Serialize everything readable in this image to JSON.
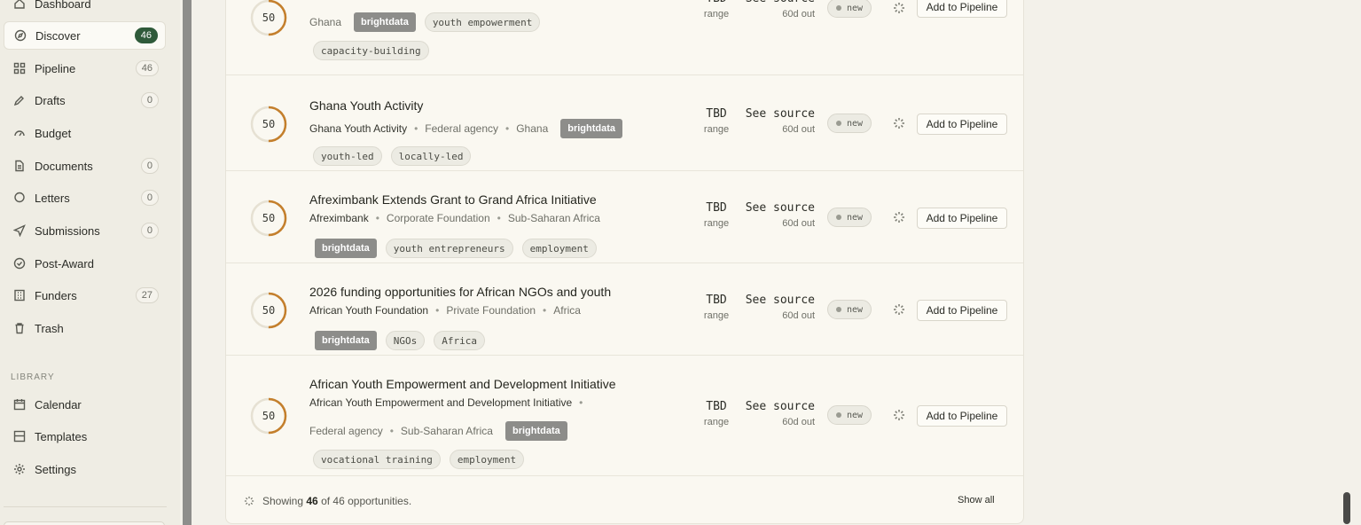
{
  "sidebar": {
    "items": [
      {
        "label": "Dashboard",
        "icon": "home-icon",
        "badge": ""
      },
      {
        "label": "Discover",
        "icon": "compass-icon",
        "badge": "46"
      },
      {
        "label": "Pipeline",
        "icon": "pipeline-icon",
        "badge": "46"
      },
      {
        "label": "Drafts",
        "icon": "pen-icon",
        "badge": "0"
      },
      {
        "label": "Budget",
        "icon": "gauge-icon",
        "badge": ""
      },
      {
        "label": "Documents",
        "icon": "document-icon",
        "badge": "0"
      },
      {
        "label": "Letters",
        "icon": "chat-icon",
        "badge": "0"
      },
      {
        "label": "Submissions",
        "icon": "send-icon",
        "badge": "0"
      },
      {
        "label": "Post-Award",
        "icon": "check-circle-icon",
        "badge": ""
      },
      {
        "label": "Funders",
        "icon": "building-icon",
        "badge": "27"
      },
      {
        "label": "Trash",
        "icon": "trash-icon",
        "badge": ""
      }
    ],
    "library_label": "LIBRARY",
    "library": [
      {
        "label": "Calendar",
        "icon": "calendar-icon"
      },
      {
        "label": "Templates",
        "icon": "template-icon"
      },
      {
        "label": "Settings",
        "icon": "gear-icon"
      }
    ]
  },
  "opportunities": [
    {
      "score": "50",
      "score_fraction": 0.5,
      "title": "",
      "meta": [
        "Ghana"
      ],
      "inline_brand": true,
      "inline_tags": [
        "youth empowerment"
      ],
      "tags_brand": false,
      "tags": [
        "capacity-building"
      ],
      "amount": "TBD",
      "amount_sub": "range",
      "deadline": "See source",
      "deadline_sub": "60d out",
      "status": "new",
      "action": "Add to Pipeline"
    },
    {
      "score": "50",
      "score_fraction": 0.5,
      "title": "Ghana Youth Activity",
      "meta": [
        "Ghana Youth Activity",
        "Federal agency",
        "Ghana"
      ],
      "inline_brand": true,
      "inline_tags": [],
      "tags_brand": false,
      "tags": [
        "youth-led",
        "locally-led"
      ],
      "amount": "TBD",
      "amount_sub": "range",
      "deadline": "See source",
      "deadline_sub": "60d out",
      "status": "new",
      "action": "Add to Pipeline"
    },
    {
      "score": "50",
      "score_fraction": 0.5,
      "title": "Afreximbank Extends Grant to Grand Africa Initiative",
      "meta": [
        "Afreximbank",
        "Corporate Foundation",
        "Sub-Saharan Africa"
      ],
      "inline_brand": false,
      "inline_tags": [],
      "tags_brand": true,
      "tags": [
        "youth entrepreneurs",
        "employment"
      ],
      "amount": "TBD",
      "amount_sub": "range",
      "deadline": "See source",
      "deadline_sub": "60d out",
      "status": "new",
      "action": "Add to Pipeline"
    },
    {
      "score": "50",
      "score_fraction": 0.5,
      "title": "2026 funding opportunities for African NGOs and youth",
      "meta": [
        "African Youth Foundation",
        "Private Foundation",
        "Africa"
      ],
      "inline_brand": false,
      "inline_tags": [],
      "tags_brand": true,
      "tags": [
        "NGOs",
        "Africa"
      ],
      "amount": "TBD",
      "amount_sub": "range",
      "deadline": "See source",
      "deadline_sub": "60d out",
      "status": "new",
      "action": "Add to Pipeline"
    },
    {
      "score": "50",
      "score_fraction": 0.5,
      "title": "African Youth Empowerment and Development Initiative",
      "meta": [
        "African Youth Empowerment and Development Initiative"
      ],
      "meta2": [
        "Federal agency",
        "Sub-Saharan Africa"
      ],
      "inline_brand": true,
      "inline_tags": [],
      "tags_brand": false,
      "tags": [
        "vocational training",
        "employment"
      ],
      "amount": "TBD",
      "amount_sub": "range",
      "deadline": "See source",
      "deadline_sub": "60d out",
      "status": "new",
      "action": "Add to Pipeline"
    }
  ],
  "brand_tag": "brightdata",
  "footer": {
    "prefix": "Showing",
    "shown": "46",
    "middle": "of 46 opportunities.",
    "show_all": "Show all"
  },
  "colors": {
    "score_ring": "#c47f2c",
    "score_track": "#e6e1d3",
    "active_badge": "#2f5a3a",
    "brand_tag": "#8d8d8a"
  }
}
